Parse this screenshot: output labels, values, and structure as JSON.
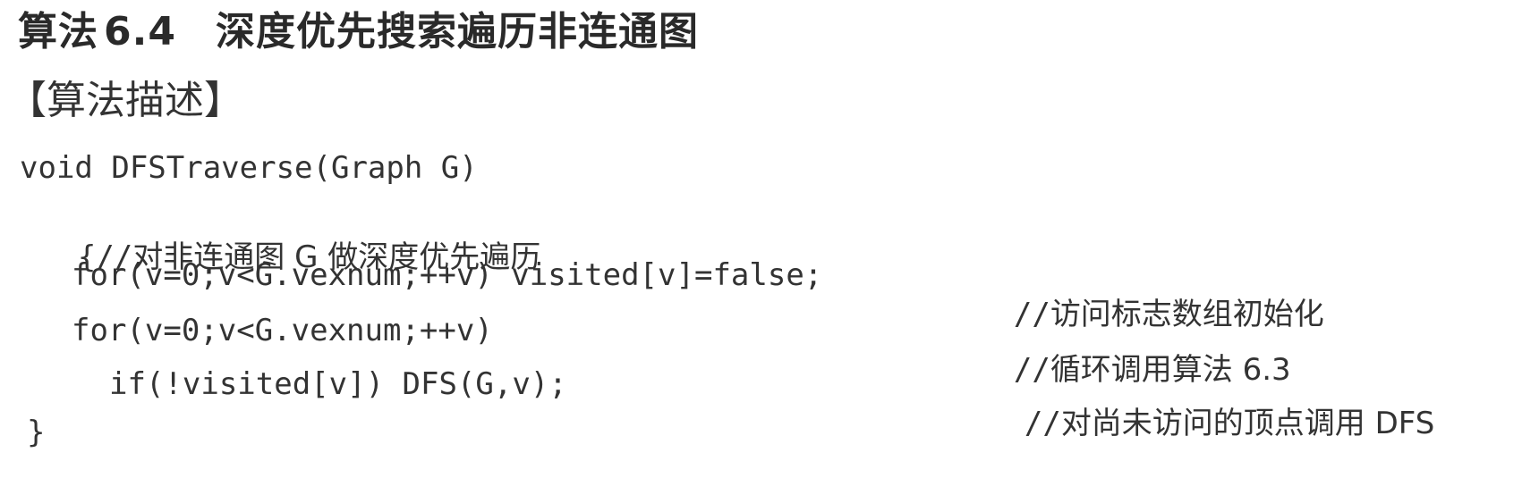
{
  "heading": {
    "label": "算法",
    "number": "6.4",
    "title": "深度优先搜索遍历非连通图"
  },
  "subheading": {
    "text": "【算法描述】"
  },
  "code": {
    "line1": "void DFSTraverse(Graph G)",
    "line2_brace": "{//",
    "line2_comment": "对非连通图 G 做深度优先遍历",
    "line3_code": "for(v=0;v<G.vexnum;++v) visited[v]=false;",
    "line3_comment_prefix": "//",
    "line3_comment": "访问标志数组初始化",
    "line4_code": "for(v=0;v<G.vexnum;++v)",
    "line4_comment_prefix": "//",
    "line4_comment": "循环调用算法 6.3",
    "line5_code": "if(!visited[v]) DFS(G,v);",
    "line5_comment_prefix": "//",
    "line5_comment": "对尚未访问的顶点调用 DFS",
    "line6": "}"
  }
}
